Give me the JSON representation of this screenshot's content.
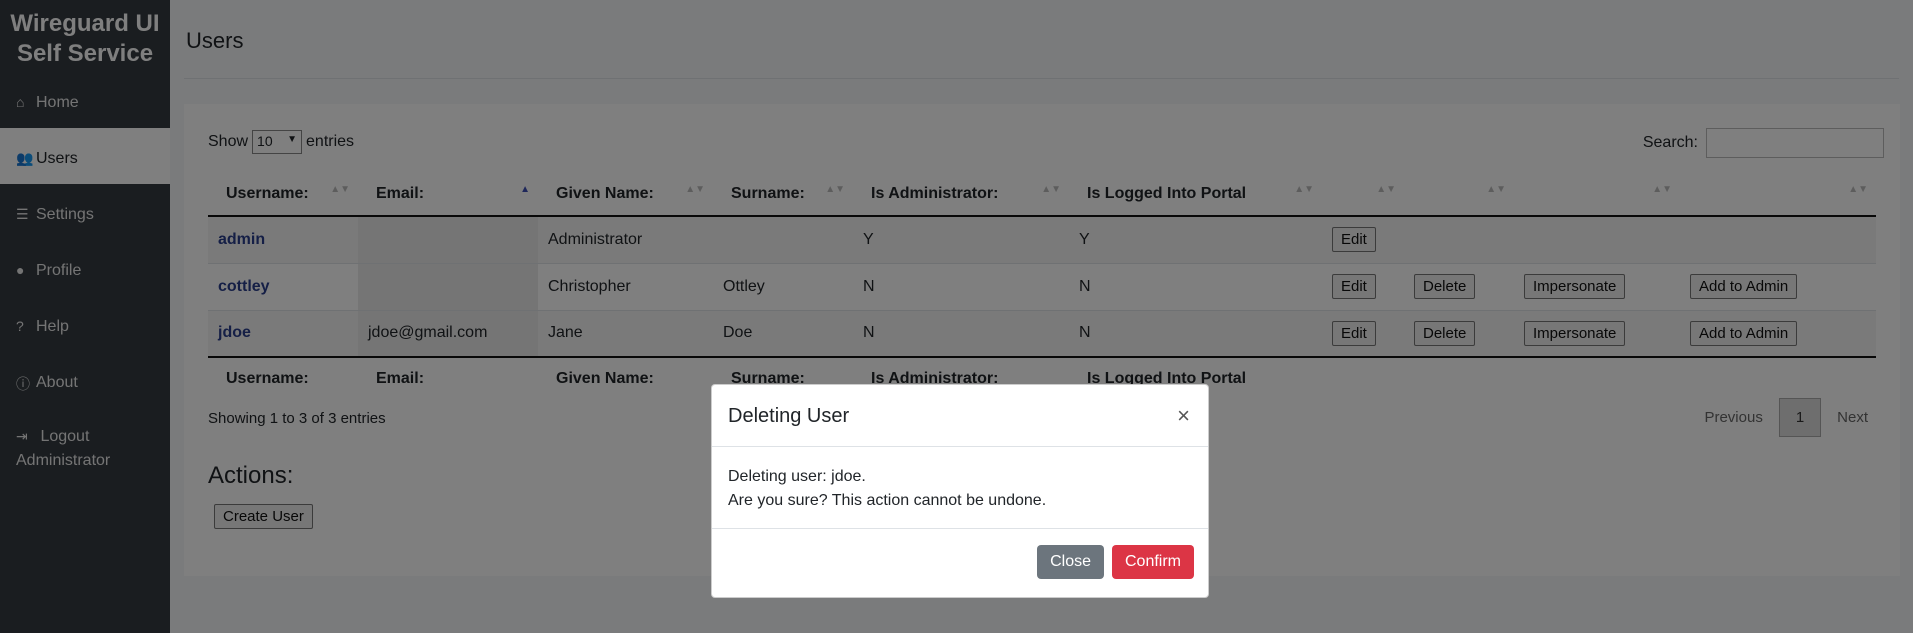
{
  "sidebar": {
    "brand_line1": "Wireguard UI",
    "brand_line2": "Self Service",
    "items": [
      {
        "label": "Home",
        "icon": "home-icon"
      },
      {
        "label": "Users",
        "icon": "users-icon",
        "active": true
      },
      {
        "label": "Settings",
        "icon": "sliders-icon"
      },
      {
        "label": "Profile",
        "icon": "user-circle-icon"
      },
      {
        "label": "Help",
        "icon": "question-circle-icon"
      },
      {
        "label": "About",
        "icon": "info-circle-icon"
      },
      {
        "label_line1": "Logout",
        "label_line2": "Administrator",
        "icon": "sign-out-icon"
      }
    ]
  },
  "page": {
    "title": "Users"
  },
  "table_controls": {
    "show_label": "Show",
    "entries_value": "10",
    "entries_label": "entries",
    "search_label": "Search:"
  },
  "table": {
    "headers": [
      "Username:",
      "Email:",
      "Given Name:",
      "Surname:",
      "Is Administrator:",
      "Is Logged Into Portal",
      "",
      "",
      "",
      ""
    ],
    "rows": [
      {
        "username": "admin",
        "email": "",
        "given": "Administrator",
        "surname": "",
        "is_admin": "Y",
        "logged_in": "Y",
        "edit": "Edit"
      },
      {
        "username": "cottley",
        "email": "",
        "given": "Christopher",
        "surname": "Ottley",
        "is_admin": "N",
        "logged_in": "N",
        "edit": "Edit",
        "delete": "Delete",
        "impersonate": "Impersonate",
        "add_admin": "Add to Admin"
      },
      {
        "username": "jdoe",
        "email": "jdoe@gmail.com",
        "given": "Jane",
        "surname": "Doe",
        "is_admin": "N",
        "logged_in": "N",
        "edit": "Edit",
        "delete": "Delete",
        "impersonate": "Impersonate",
        "add_admin": "Add to Admin"
      }
    ],
    "info": "Showing 1 to 3 of 3 entries",
    "pager": {
      "previous": "Previous",
      "current": "1",
      "next": "Next"
    }
  },
  "actions": {
    "title": "Actions:",
    "create_user": "Create User"
  },
  "modal": {
    "title": "Deleting User",
    "close_x": "×",
    "line1": "Deleting user: jdoe.",
    "line2": "Are you sure? This action cannot be undone.",
    "close_label": "Close",
    "confirm_label": "Confirm"
  },
  "colors": {
    "sidebar_bg": "#343a40",
    "confirm": "#dc3545",
    "close": "#6c757d"
  }
}
